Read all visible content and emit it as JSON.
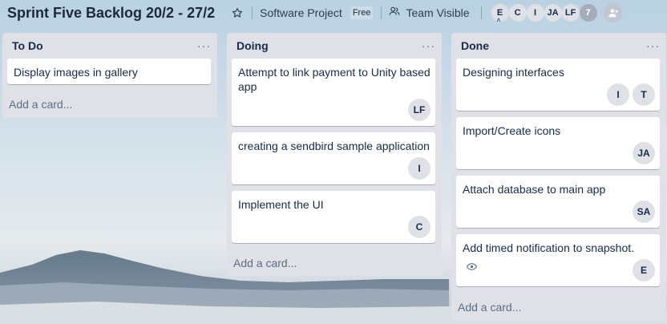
{
  "board": {
    "title": "Sprint Five Backlog 20/2 - 27/2",
    "star_icon": "star-icon",
    "org_name": "Software Project",
    "plan_badge": "Free",
    "visibility_icon": "team-icon",
    "visibility_label": "Team Visible",
    "members": [
      {
        "initials": "E",
        "admin": true
      },
      {
        "initials": "C",
        "admin": false
      },
      {
        "initials": "I",
        "admin": false
      },
      {
        "initials": "JA",
        "admin": false
      },
      {
        "initials": "LF",
        "admin": false
      }
    ],
    "more_members": "7",
    "invite_icon": "add-member-icon"
  },
  "lists": [
    {
      "title": "To Do",
      "menu": "...",
      "add_card": "Add a card...",
      "cards": [
        {
          "title": "Display images in gallery",
          "members": []
        }
      ]
    },
    {
      "title": "Doing",
      "menu": "...",
      "add_card": "Add a card...",
      "cards": [
        {
          "title": "Attempt to link payment to Unity based app",
          "members": [
            "LF"
          ]
        },
        {
          "title": "creating a sendbird sample application",
          "members": [
            "I"
          ]
        },
        {
          "title": "Implement the UI",
          "members": [
            "C"
          ]
        }
      ]
    },
    {
      "title": "Done",
      "menu": "...",
      "add_card": "Add a card...",
      "cards": [
        {
          "title": "Designing interfaces",
          "members": [
            "I",
            "T"
          ]
        },
        {
          "title": "Import/Create icons",
          "members": [
            "JA"
          ]
        },
        {
          "title": "Attach database to main app",
          "members": [
            "SA"
          ]
        },
        {
          "title": "Add timed notification to snapshot.",
          "members": [
            "E"
          ],
          "badge_icon": "eye-icon"
        }
      ]
    }
  ]
}
